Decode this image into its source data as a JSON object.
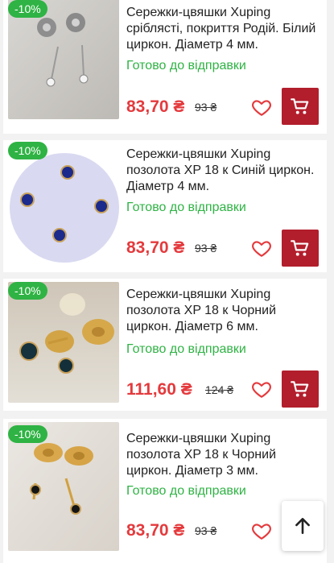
{
  "products": [
    {
      "discount": "-10%",
      "title": "Сережки-цвяшки Xuping сріблясті, покриття Родій. Білий циркон. Діаметр 4 мм.",
      "status": "Готово до відправки",
      "price": "83,70 ₴",
      "old_price": "93 ₴"
    },
    {
      "discount": "-10%",
      "title": "Сережки-цвяшки Xuping позолота XP 18 к Синій циркон. Діаметр 4 мм.",
      "status": "Готово до відправки",
      "price": "83,70 ₴",
      "old_price": "93 ₴"
    },
    {
      "discount": "-10%",
      "title": "Сережки-цвяшки Xuping позолота XP 18 к Чорний циркон. Діаметр 6 мм.",
      "status": "Готово до відправки",
      "price": "111,60 ₴",
      "old_price": "124 ₴"
    },
    {
      "discount": "-10%",
      "title": "Сережки-цвяшки Xuping позолота XP 18 к Чорний циркон. Діаметр 3 мм.",
      "status": "Готово до відправки",
      "price": "83,70 ₴",
      "old_price": "93 ₴"
    }
  ],
  "colors": {
    "accent_red": "#e43a3d",
    "cart_button": "#b21e2c",
    "status_green": "#2fb344",
    "badge_green": "#2fb344"
  },
  "icons": {
    "wishlist": "heart-outline-icon",
    "cart": "shopping-cart-icon",
    "scroll_top": "arrow-up-icon"
  }
}
